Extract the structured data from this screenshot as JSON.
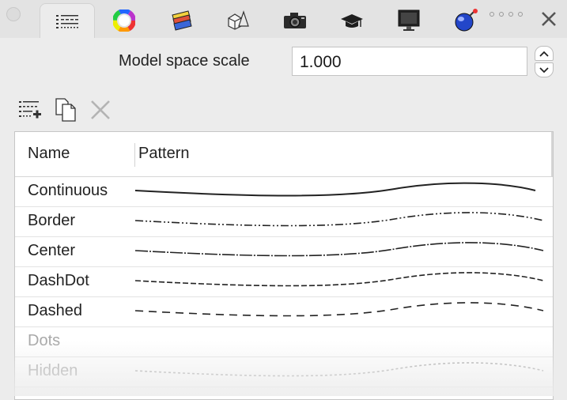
{
  "panel": {
    "tabs": [
      {
        "icon": "linetype-list-icon",
        "active": true
      },
      {
        "icon": "color-wheel-icon"
      },
      {
        "icon": "layers-icon"
      },
      {
        "icon": "shapes-icon"
      },
      {
        "icon": "camera-icon"
      },
      {
        "icon": "graduation-cap-icon"
      },
      {
        "icon": "monitor-icon"
      },
      {
        "icon": "sphere-icon"
      }
    ],
    "scale": {
      "label": "Model space scale",
      "value": "1.000"
    },
    "toolbar": [
      {
        "icon": "new-linetype-icon"
      },
      {
        "icon": "duplicate-icon"
      },
      {
        "icon": "delete-icon"
      }
    ],
    "table": {
      "columns": [
        "Name",
        "Pattern"
      ],
      "rows": [
        {
          "name": "Continuous",
          "pattern": "solid"
        },
        {
          "name": "Border",
          "pattern": "dashdotdot"
        },
        {
          "name": "Center",
          "pattern": "center"
        },
        {
          "name": "DashDot",
          "pattern": "dashdot"
        },
        {
          "name": "Dashed",
          "pattern": "dashed"
        },
        {
          "name": "Dots",
          "pattern": "none"
        },
        {
          "name": "Hidden",
          "pattern": "hidden"
        }
      ]
    }
  },
  "colors": {
    "background": "#ececec",
    "tabbar": "#e3e3e3",
    "line": "#222222"
  }
}
